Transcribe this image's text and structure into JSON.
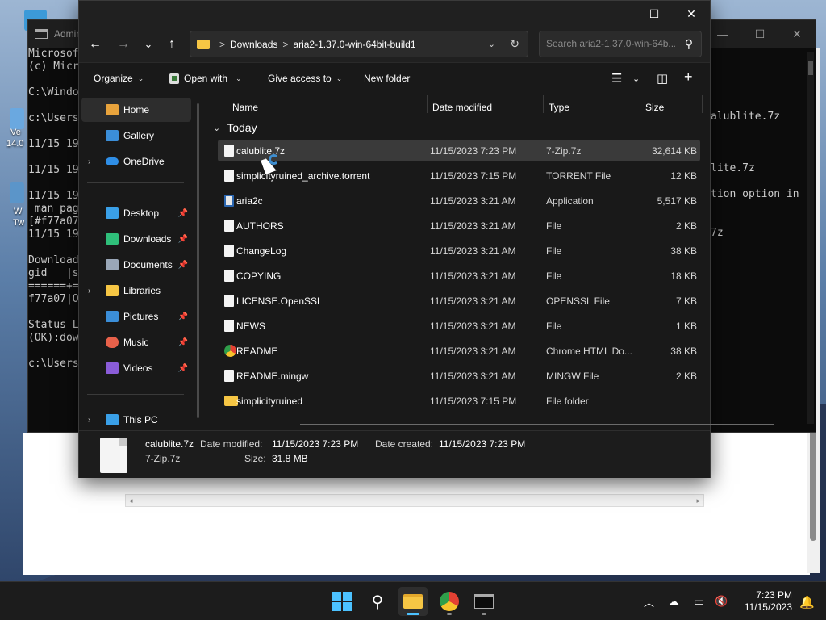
{
  "desktop": {
    "labels": [
      "Ve",
      "14.0",
      "W",
      "Tw"
    ]
  },
  "terminal": {
    "title": "Admin",
    "left_lines": [
      "Microsof",
      "(c) Micr",
      "",
      "C:\\Windo",
      "",
      "c:\\Users",
      "",
      "11/15 19",
      "",
      "11/15 19",
      "",
      "11/15 19",
      " man pag",
      "[#f77a07",
      "11/15 19",
      "",
      "Download",
      "gid   |s",
      "======+=",
      "f77a07|O",
      "",
      "Status L",
      "(OK):dow",
      "",
      "c:\\Users"
    ],
    "right_lines": [
      "alublite.7z",
      "",
      "",
      "",
      "lite.7z",
      "",
      "tion option in",
      "",
      "",
      "7z"
    ]
  },
  "explorer": {
    "controls": {
      "minimize": "—",
      "maximize": "☐",
      "close": "✕"
    },
    "nav": {
      "back": "←",
      "forward": "→",
      "recent": "⌄",
      "up": "↑"
    },
    "address": {
      "crumbs": [
        "Downloads",
        "aria2-1.37.0-win-64bit-build1"
      ],
      "separator": ">"
    },
    "search": {
      "placeholder": "Search aria2-1.37.0-win-64b..."
    },
    "toolbar": {
      "organize": "Organize",
      "open_with": "Open with",
      "give_access": "Give access to",
      "new_folder": "New folder"
    },
    "sidebar": {
      "items": [
        {
          "label": "Home",
          "icon": "home-icon",
          "color": "#e8a33c"
        },
        {
          "label": "Gallery",
          "icon": "gallery-icon",
          "color": "#3b8ed8"
        },
        {
          "label": "OneDrive",
          "icon": "cloud-icon",
          "color": "#2f8ee6"
        },
        {
          "label": "Desktop",
          "icon": "desktop-icon",
          "color": "#3aa0e8"
        },
        {
          "label": "Downloads",
          "icon": "download-icon",
          "color": "#2fbf7a"
        },
        {
          "label": "Documents",
          "icon": "documents-icon",
          "color": "#9aa7b8"
        },
        {
          "label": "Libraries",
          "icon": "library-icon",
          "color": "#f6c644"
        },
        {
          "label": "Pictures",
          "icon": "pictures-icon",
          "color": "#3b8ed8"
        },
        {
          "label": "Music",
          "icon": "music-icon",
          "color": "#e8614a"
        },
        {
          "label": "Videos",
          "icon": "videos-icon",
          "color": "#8a5cd8"
        },
        {
          "label": "This PC",
          "icon": "pc-icon",
          "color": "#3aa0e8"
        }
      ]
    },
    "columns": {
      "name": "Name",
      "date": "Date modified",
      "type": "Type",
      "size": "Size"
    },
    "group": "Today",
    "files": [
      {
        "name": "calublite.7z",
        "date": "11/15/2023 7:23 PM",
        "type": "7-Zip.7z",
        "size": "32,614 KB"
      },
      {
        "name": "simplicityruined_archive.torrent",
        "date": "11/15/2023 7:15 PM",
        "type": "TORRENT File",
        "size": "12 KB"
      },
      {
        "name": "aria2c",
        "date": "11/15/2023 3:21 AM",
        "type": "Application",
        "size": "5,517 KB"
      },
      {
        "name": "AUTHORS",
        "date": "11/15/2023 3:21 AM",
        "type": "File",
        "size": "2 KB"
      },
      {
        "name": "ChangeLog",
        "date": "11/15/2023 3:21 AM",
        "type": "File",
        "size": "38 KB"
      },
      {
        "name": "COPYING",
        "date": "11/15/2023 3:21 AM",
        "type": "File",
        "size": "18 KB"
      },
      {
        "name": "LICENSE.OpenSSL",
        "date": "11/15/2023 3:21 AM",
        "type": "OPENSSL File",
        "size": "7 KB"
      },
      {
        "name": "NEWS",
        "date": "11/15/2023 3:21 AM",
        "type": "File",
        "size": "1 KB"
      },
      {
        "name": "README",
        "date": "11/15/2023 3:21 AM",
        "type": "Chrome HTML Do...",
        "size": "38 KB"
      },
      {
        "name": "README.mingw",
        "date": "11/15/2023 3:21 AM",
        "type": "MINGW File",
        "size": "2 KB"
      },
      {
        "name": "simplicityruined",
        "date": "11/15/2023 7:15 PM",
        "type": "File folder",
        "size": ""
      }
    ],
    "details": {
      "filename": "calublite.7z",
      "filetype": "7-Zip.7z",
      "modified_label": "Date modified:",
      "modified_value": "11/15/2023 7:23 PM",
      "created_label": "Date created:",
      "created_value": "11/15/2023 7:23 PM",
      "size_label": "Size:",
      "size_value": "31.8 MB"
    }
  },
  "taskbar": {
    "clock_time": "7:23 PM",
    "clock_date": "11/15/2023",
    "accent": "#4cc2ff"
  }
}
